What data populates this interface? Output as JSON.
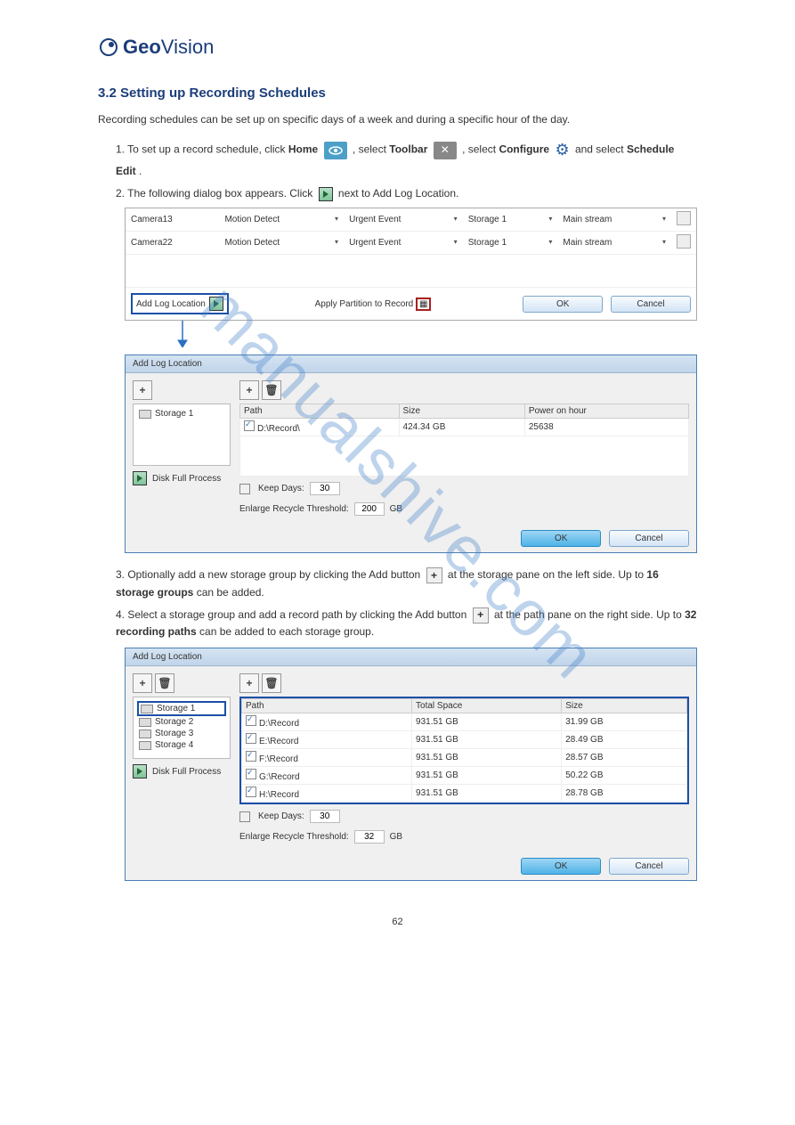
{
  "logo": {
    "main": "Geo",
    "sub": "Vision"
  },
  "sectionTitle": "3.2  Setting up Recording Schedules",
  "intro": "Recording schedules can be set up on specific days of a week and during a specific hour of the day.",
  "step1": {
    "prefix": "1. To set up a record schedule, click ",
    "home": "Home",
    "mid1": " , select ",
    "toolbar": "Toolbar",
    "mid2": " , select ",
    "configure": "Configure",
    "mid3": " and select ",
    "schedule": "Schedule Edit",
    "end": "."
  },
  "step2": "2. The following dialog box appears. Click ",
  "step2end": " next to Add Log Location.",
  "topTable": {
    "rows": [
      {
        "cam": "Camera13",
        "mode": "Motion Detect",
        "ev": "Urgent Event",
        "stg": "Storage 1",
        "stream": "Main stream"
      },
      {
        "cam": "Camera22",
        "mode": "Motion Detect",
        "ev": "Urgent Event",
        "stg": "Storage 1",
        "stream": "Main stream"
      }
    ],
    "addLogLabel": "Add Log Location",
    "applyPartition": "Apply Partition to Record",
    "ok": "OK",
    "cancel": "Cancel"
  },
  "dialog1": {
    "title": "Add Log Location",
    "storage": "Storage 1",
    "diskfull": "Disk Full Process",
    "cols": {
      "path": "Path",
      "size": "Size",
      "power": "Power on hour"
    },
    "row": {
      "path": "D:\\Record\\",
      "size": "424.34 GB",
      "power": "25638"
    },
    "keep": "Keep Days:",
    "keepVal": "30",
    "enlarge": "Enlarge Recycle Threshold:",
    "enlargeVal": "200",
    "gb": "GB",
    "ok": "OK",
    "cancel": "Cancel"
  },
  "step3": {
    "prefix": "3. Optionally add a new storage group by clicking the Add button ",
    "mid": " at the storage pane on the left side. Up to ",
    "sixteen": "16 storage groups",
    "end": " can be added."
  },
  "step4": {
    "prefix": "4. Select a storage group and add a record path by clicking the Add button ",
    "mid": " at the path pane on the right side. Up to ",
    "sixteen": "32 recording paths",
    "end": " can be added to each storage group."
  },
  "dialog2": {
    "title": "Add Log Location",
    "storages": [
      "Storage 1",
      "Storage 2",
      "Storage 3",
      "Storage 4"
    ],
    "diskfull": "Disk Full Process",
    "cols": {
      "path": "Path",
      "total": "Total Space",
      "size": "Size"
    },
    "rows": [
      {
        "path": "D:\\Record",
        "total": "931.51 GB",
        "size": "31.99 GB"
      },
      {
        "path": "E:\\Record",
        "total": "931.51 GB",
        "size": "28.49 GB"
      },
      {
        "path": "F:\\Record",
        "total": "931.51 GB",
        "size": "28.57 GB"
      },
      {
        "path": "G:\\Record",
        "total": "931.51 GB",
        "size": "50.22 GB"
      },
      {
        "path": "H:\\Record",
        "total": "931.51 GB",
        "size": "28.78 GB"
      }
    ],
    "keep": "Keep Days:",
    "keepVal": "30",
    "enlarge": "Enlarge Recycle Threshold:",
    "enlargeVal": "32",
    "gb": "GB",
    "ok": "OK",
    "cancel": "Cancel"
  },
  "pageNum": "62",
  "watermark": "manualshive.com"
}
